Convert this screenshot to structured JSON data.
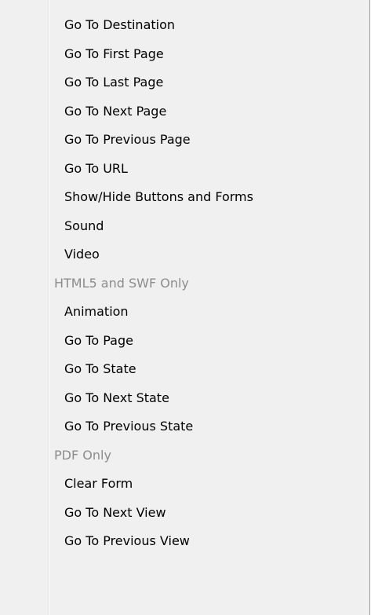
{
  "menu": {
    "group1": [
      "Go To Destination",
      "Go To First Page",
      "Go To Last Page",
      "Go To Next Page",
      "Go To Previous Page",
      "Go To URL",
      "Show/Hide Buttons and Forms",
      "Sound",
      "Video"
    ],
    "header_html5": "HTML5 and SWF Only",
    "group2": [
      "Animation",
      "Go To Page",
      "Go To State",
      "Go To Next State",
      "Go To Previous State"
    ],
    "header_pdf": "PDF Only",
    "group3": [
      "Clear Form",
      "Go To Next View",
      "Go To Previous View"
    ]
  }
}
